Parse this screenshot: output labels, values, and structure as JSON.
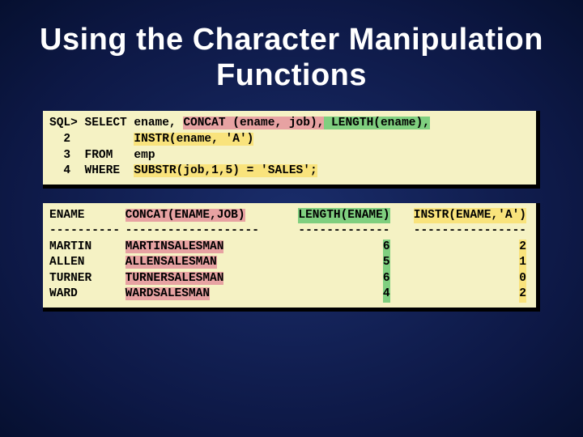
{
  "title": "Using the Character Manipulation Functions",
  "query": {
    "l1_a": "SQL> SELECT ename, ",
    "l1_b": "CONCAT (ename, job),",
    "l1_c": " LENGTH(ename),",
    "l2_a": "  2         ",
    "l2_b": "INSTR(ename, 'A')",
    "l3": "  3  FROM   emp",
    "l4_a": "  4  WHERE  ",
    "l4_b": "SUBSTR(job,1,5) = 'SALES';"
  },
  "header": {
    "c1": "ENAME",
    "c2": "CONCAT(ENAME,JOB)",
    "c3": "LENGTH(ENAME)",
    "c4": "INSTR(ENAME,'A')"
  },
  "separator": {
    "c1": "----------",
    "c2": "-------------------",
    "c3": "-------------",
    "c4": "----------------"
  },
  "rows": [
    {
      "ename": "MARTIN",
      "concat": "MARTINSALESMAN",
      "len": "6",
      "instr": "2"
    },
    {
      "ename": "ALLEN",
      "concat": "ALLENSALESMAN",
      "len": "5",
      "instr": "1"
    },
    {
      "ename": "TURNER",
      "concat": "TURNERSALESMAN",
      "len": "6",
      "instr": "0"
    },
    {
      "ename": "WARD",
      "concat": "WARDSALESMAN",
      "len": "4",
      "instr": "2"
    }
  ]
}
